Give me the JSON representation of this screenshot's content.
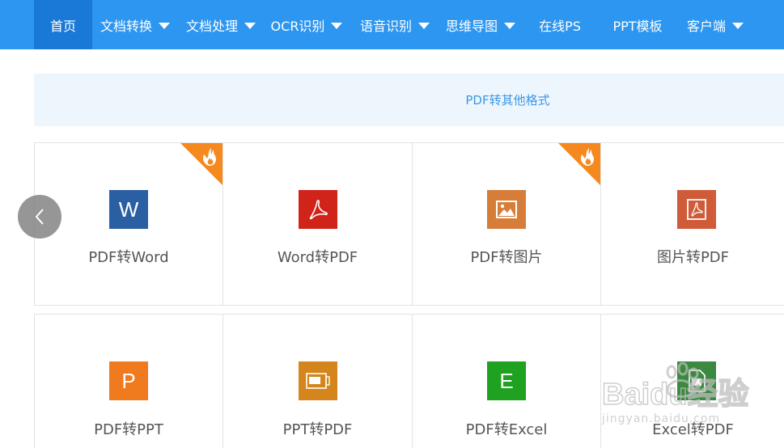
{
  "nav": {
    "items": [
      {
        "label": "首页",
        "active": true,
        "dropdown": false
      },
      {
        "label": "文档转换",
        "dropdown": true
      },
      {
        "label": "文档处理",
        "dropdown": true
      },
      {
        "label": "OCR识别",
        "dropdown": true
      },
      {
        "label": "语音识别",
        "dropdown": true
      },
      {
        "label": "思维导图",
        "dropdown": true
      },
      {
        "label": "在线PS",
        "dropdown": false
      },
      {
        "label": "PPT模板",
        "dropdown": false
      },
      {
        "label": "客户端",
        "dropdown": true
      }
    ]
  },
  "banner": {
    "label": "PDF转其他格式"
  },
  "tools": {
    "row1": [
      {
        "label": "PDF转Word",
        "icon": "word-icon",
        "color": "#2b5fa3",
        "hot": true
      },
      {
        "label": "Word转PDF",
        "icon": "acrobat-icon",
        "color": "#d0231a",
        "hot": false
      },
      {
        "label": "PDF转图片",
        "icon": "image-icon",
        "color": "#d77d3a",
        "hot": true
      },
      {
        "label": "图片转PDF",
        "icon": "acrobat-icon",
        "color": "#cf5b38",
        "hot": false
      }
    ],
    "row2": [
      {
        "label": "PDF转PPT",
        "icon": "powerpoint-icon",
        "color": "#f07a1e",
        "hot": false
      },
      {
        "label": "PPT转PDF",
        "icon": "ppt-pdf-icon",
        "color": "#d4851b",
        "hot": false
      },
      {
        "label": "PDF转Excel",
        "icon": "excel-icon",
        "color": "#1fa21f",
        "hot": false
      },
      {
        "label": "Excel转PDF",
        "icon": "excel-pdf-icon",
        "color": "#3b8a3f",
        "hot": false
      }
    ]
  },
  "icon_glyphs": {
    "word": "W",
    "powerpoint": "P",
    "excel": "E"
  },
  "watermark": {
    "brand": "Baidu经验",
    "url": "jingyan.baidu.com"
  },
  "colors": {
    "nav_bg": "#2d96f0",
    "nav_active": "#1a79d6",
    "banner_bg": "#eef6fd",
    "banner_text": "#3c97e4",
    "hot_badge": "#f5891f"
  }
}
